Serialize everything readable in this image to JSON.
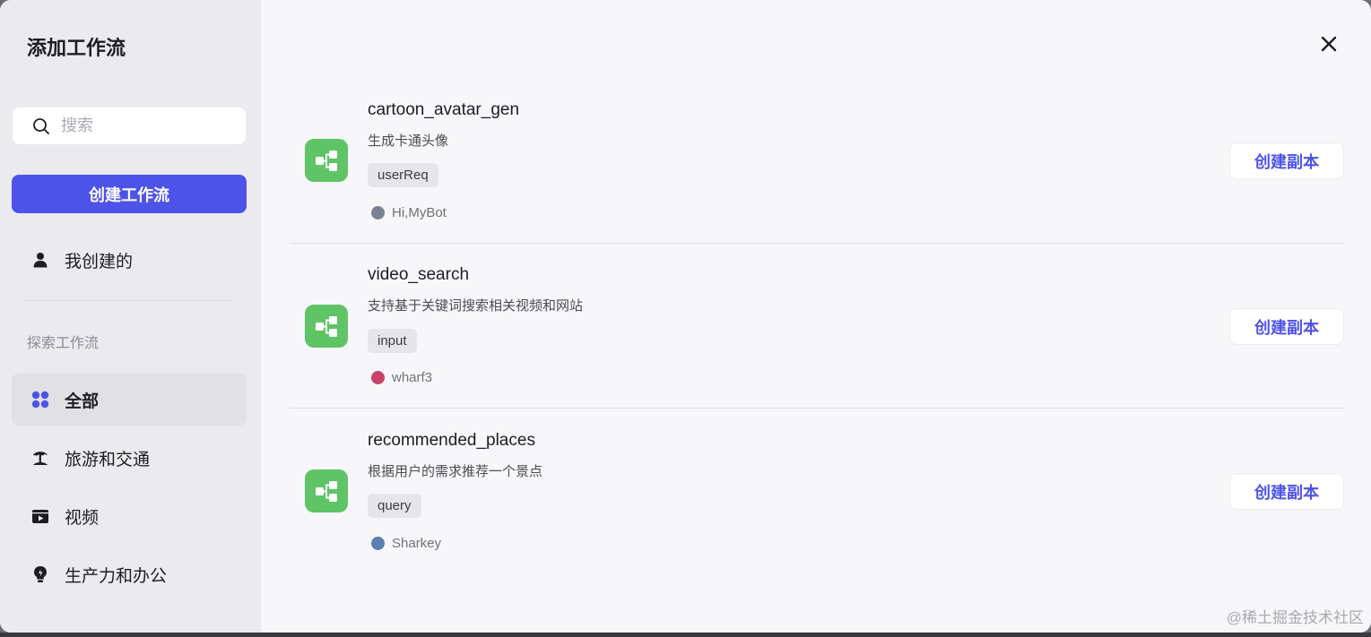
{
  "dialog_title": "添加工作流",
  "search": {
    "placeholder": "搜索",
    "icon": "search-icon"
  },
  "create_button": "创建工作流",
  "my_created": {
    "label": "我创建的",
    "icon": "person-icon"
  },
  "explore_label": "探索工作流",
  "categories": [
    {
      "label": "全部",
      "icon": "grid-icon",
      "active": true
    },
    {
      "label": "旅游和交通",
      "icon": "beach-icon",
      "active": false
    },
    {
      "label": "视频",
      "icon": "video-icon",
      "active": false
    },
    {
      "label": "生产力和办公",
      "icon": "bulb-icon",
      "active": false
    }
  ],
  "workflows": [
    {
      "name": "cartoon_avatar_gen",
      "desc": "生成卡通头像",
      "tag": "userReq",
      "author": "Hi,MyBot",
      "action": "创建副本"
    },
    {
      "name": "video_search",
      "desc": "支持基于关键词搜索相关视频和网站",
      "tag": "input",
      "author": "wharf3",
      "action": "创建副本"
    },
    {
      "name": "recommended_places",
      "desc": "根据用户的需求推荐一个景点",
      "tag": "query",
      "author": "Sharkey",
      "action": "创建副本"
    }
  ],
  "watermark": "@稀土掘金技术社区",
  "colors": {
    "accent": "#4d53e8",
    "workflow_icon": "#5fc466",
    "sidebar_bg": "#ebebef"
  }
}
